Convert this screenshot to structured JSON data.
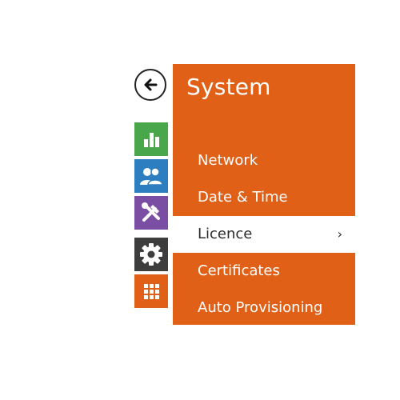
{
  "panel": {
    "title": "System"
  },
  "menu": {
    "items": [
      {
        "label": "Network"
      },
      {
        "label": "Date & Time"
      },
      {
        "label": "Licence"
      },
      {
        "label": "Certificates"
      },
      {
        "label": "Auto Provisioning"
      }
    ],
    "active_item": "Licence",
    "chevron": "›"
  },
  "sidebar": {
    "buttons": [
      {
        "icon": "bar-chart-icon",
        "color": "#4aa64a"
      },
      {
        "icon": "users-icon",
        "color": "#2c7ec1"
      },
      {
        "icon": "tools-icon",
        "color": "#7a4fa3"
      },
      {
        "icon": "gear-icon",
        "color": "#3d3d3d"
      },
      {
        "icon": "grid-icon",
        "color": "#e06017"
      }
    ]
  },
  "colors": {
    "accent": "#e06017",
    "active_bg": "#ffffff"
  }
}
